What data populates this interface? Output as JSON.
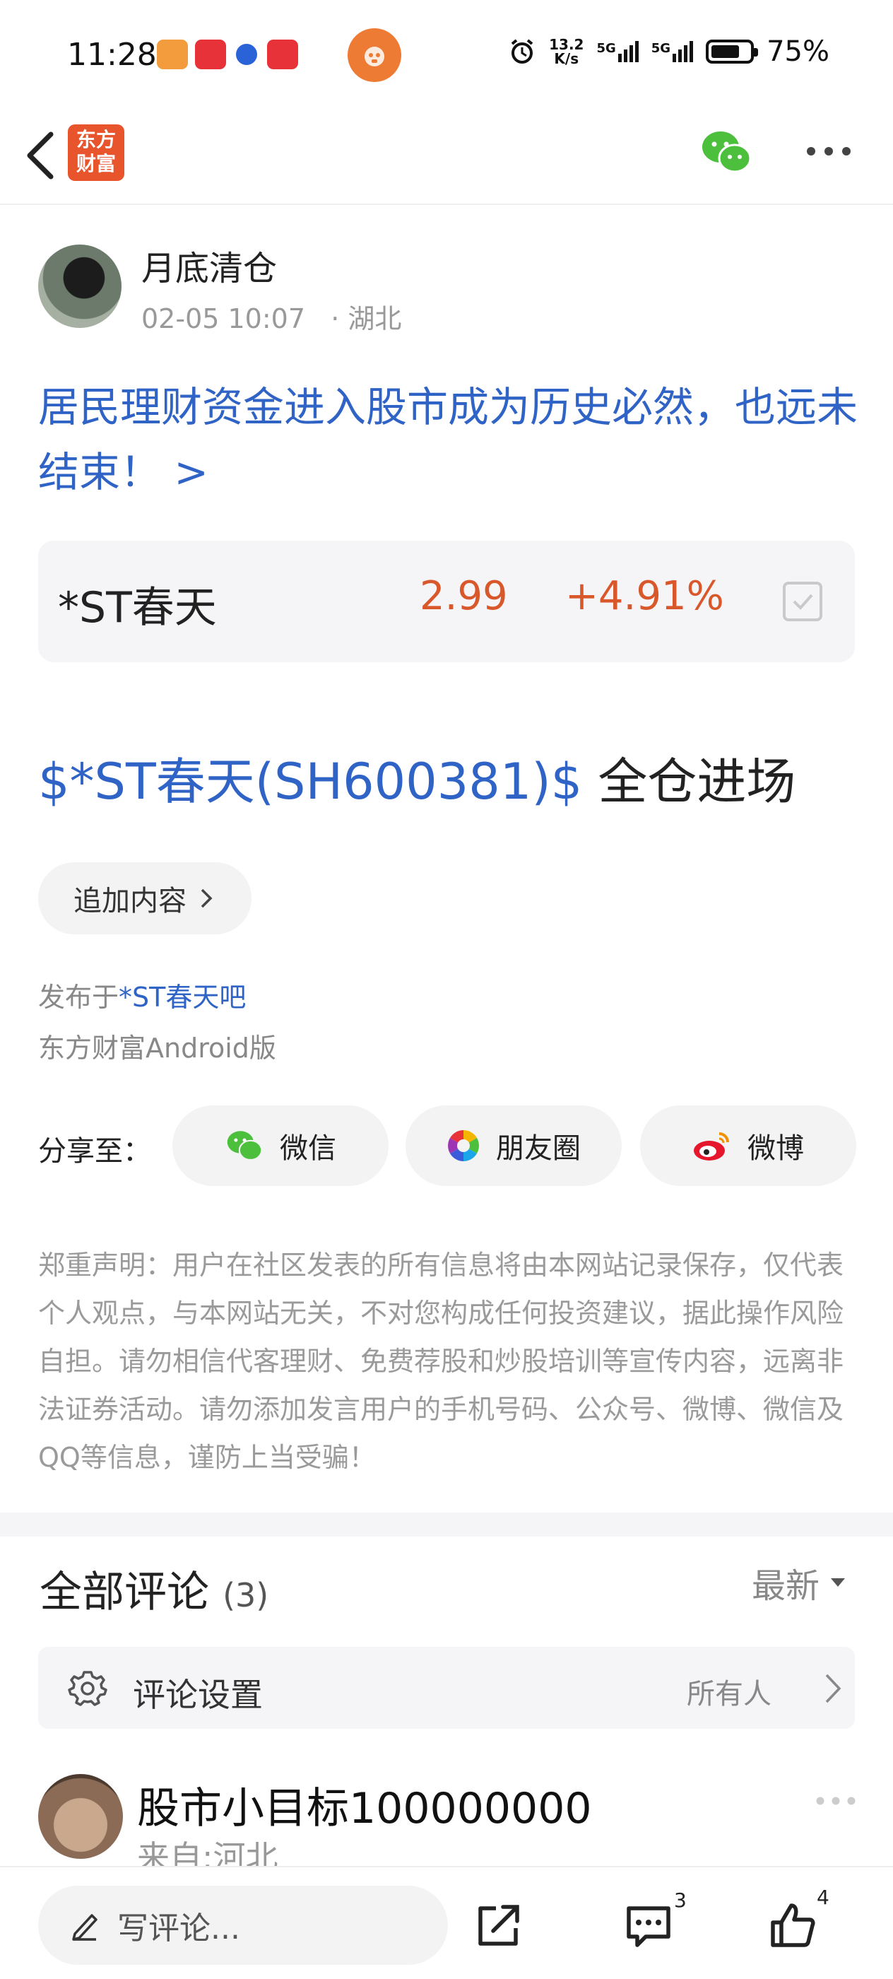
{
  "status_bar": {
    "time": "11:28",
    "net_speed_top": "13.2",
    "net_speed_bottom": "K/s",
    "signal_1": "5G",
    "signal_2": "5G",
    "battery": "75%",
    "battery_level": 0.75
  },
  "nav": {
    "logo_text_1": "东方",
    "logo_text_2": "财富"
  },
  "post": {
    "author": "月底清仓",
    "date": "02-05 10:07",
    "location": "· 湖北",
    "title": "居民理财资金进入股市成为历史必然，也远未结束！ >",
    "stock": {
      "name": "*ST春天",
      "price": "2.99",
      "change": "+4.91%"
    },
    "content_link": "$*ST春天(SH600381)$",
    "content_text": " 全仓进场",
    "add_content_label": "追加内容",
    "published_prefix": "发布于",
    "published_forum": "*ST春天吧",
    "client": "东方财富Android版"
  },
  "share": {
    "label": "分享至：",
    "wechat": "微信",
    "moments": "朋友圈",
    "weibo": "微博"
  },
  "disclaimer": "郑重声明：用户在社区发表的所有信息将由本网站记录保存，仅代表个人观点，与本网站无关，不对您构成任何投资建议，据此操作风险自担。请勿相信代客理财、免费荐股和炒股培训等宣传内容，远离非法证券活动。请勿添加发言用户的手机号码、公众号、微博、微信及QQ等信息，谨防上当受骗！",
  "comments": {
    "title": "全部评论",
    "count": "(3)",
    "sort": "最新",
    "settings_label": "评论设置",
    "settings_value": "所有人",
    "items": [
      {
        "user": "股市小目标100000000",
        "from": "来自:河北"
      }
    ]
  },
  "bottom_bar": {
    "write_placeholder": "写评论...",
    "comment_count": "3",
    "like_count": "4"
  },
  "colors": {
    "link_blue": "#2f64c6",
    "price_red": "#d9582b",
    "brand_orange": "#e8542b",
    "wechat_green": "#4cbf3d"
  }
}
